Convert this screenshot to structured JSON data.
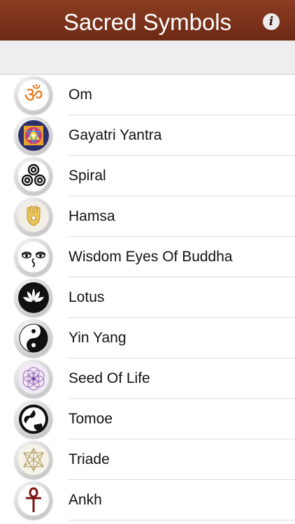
{
  "header": {
    "title": "Sacred Symbols",
    "info_icon": "info-icon"
  },
  "symbols": [
    {
      "label": "Om",
      "icon": "om-icon"
    },
    {
      "label": "Gayatri Yantra",
      "icon": "gayatri-yantra-icon"
    },
    {
      "label": "Spiral",
      "icon": "spiral-icon"
    },
    {
      "label": "Hamsa",
      "icon": "hamsa-icon"
    },
    {
      "label": "Wisdom Eyes Of Buddha",
      "icon": "wisdom-eyes-icon"
    },
    {
      "label": "Lotus",
      "icon": "lotus-icon"
    },
    {
      "label": "Yin Yang",
      "icon": "yin-yang-icon"
    },
    {
      "label": "Seed Of Life",
      "icon": "seed-of-life-icon"
    },
    {
      "label": "Tomoe",
      "icon": "tomoe-icon"
    },
    {
      "label": "Triade",
      "icon": "triade-icon"
    },
    {
      "label": "Ankh",
      "icon": "ankh-icon"
    }
  ],
  "colors": {
    "header": "#7a3219",
    "accent_om": "#e87a1e",
    "ankh": "#7a1414"
  }
}
